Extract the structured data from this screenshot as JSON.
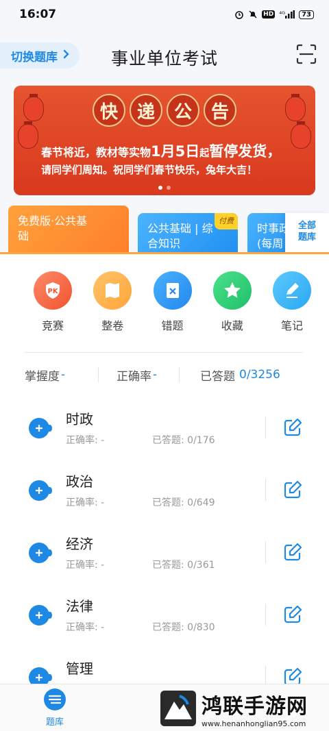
{
  "status_bar": {
    "time": "16:07",
    "network": "⁴ᴳ",
    "hd": "HD",
    "battery": "73"
  },
  "header": {
    "switch_label": "切换题库",
    "title": "事业单位考试"
  },
  "banner": {
    "title_chars": [
      "快",
      "递",
      "公",
      "告"
    ],
    "line1_prefix": "春节将近，教材等实物",
    "line1_date": "1月5日",
    "line1_mid": "起",
    "line1_suffix": "暂停发货，",
    "line2": "请同学们周知。祝同学们春节快乐，兔年大吉！",
    "slide_count": 2,
    "active_slide": 1
  },
  "bank_cards": [
    {
      "label_line1": "免费版·公共基",
      "label_line2": "础"
    },
    {
      "label_line1": "公共基础 | 综",
      "label_line2": "合知识",
      "tag": "付费"
    },
    {
      "label_line1": "时事政",
      "label_line2": "(每周"
    }
  ],
  "all_bank": {
    "line1": "全部",
    "line2": "题库"
  },
  "actions": [
    {
      "label": "竞赛",
      "icon": "pk-icon",
      "color": "#f0532e"
    },
    {
      "label": "整卷",
      "icon": "paper-icon",
      "color": "#ffa53a"
    },
    {
      "label": "错题",
      "icon": "wrong-icon",
      "color": "#2389ee"
    },
    {
      "label": "收藏",
      "icon": "star-icon",
      "color": "#20c06a"
    },
    {
      "label": "笔记",
      "icon": "pen-icon",
      "color": "#2aa8f0"
    }
  ],
  "stats": {
    "mastery_label": "掌握度",
    "mastery_value": "-",
    "accuracy_label": "正确率",
    "accuracy_value": "-",
    "answered_label": "已答题",
    "answered_value": "0/3256"
  },
  "topics": [
    {
      "name": "时政",
      "rate": "正确率: -",
      "done": "已答题: 0/176"
    },
    {
      "name": "政治",
      "rate": "正确率: -",
      "done": "已答题: 0/649"
    },
    {
      "name": "经济",
      "rate": "正确率: -",
      "done": "已答题: 0/361"
    },
    {
      "name": "法律",
      "rate": "正确率: -",
      "done": "已答题: 0/830"
    },
    {
      "name": "管理",
      "rate": "",
      "done": ""
    }
  ],
  "bottom_nav": {
    "tiku_label": "题库"
  },
  "watermark": {
    "title": "鸿联手游网",
    "url": "www.henanhonglian95.com"
  },
  "colors": {
    "accent": "#1e88e5",
    "banner_red": "#d9391d",
    "orange": "#ffa33a"
  }
}
